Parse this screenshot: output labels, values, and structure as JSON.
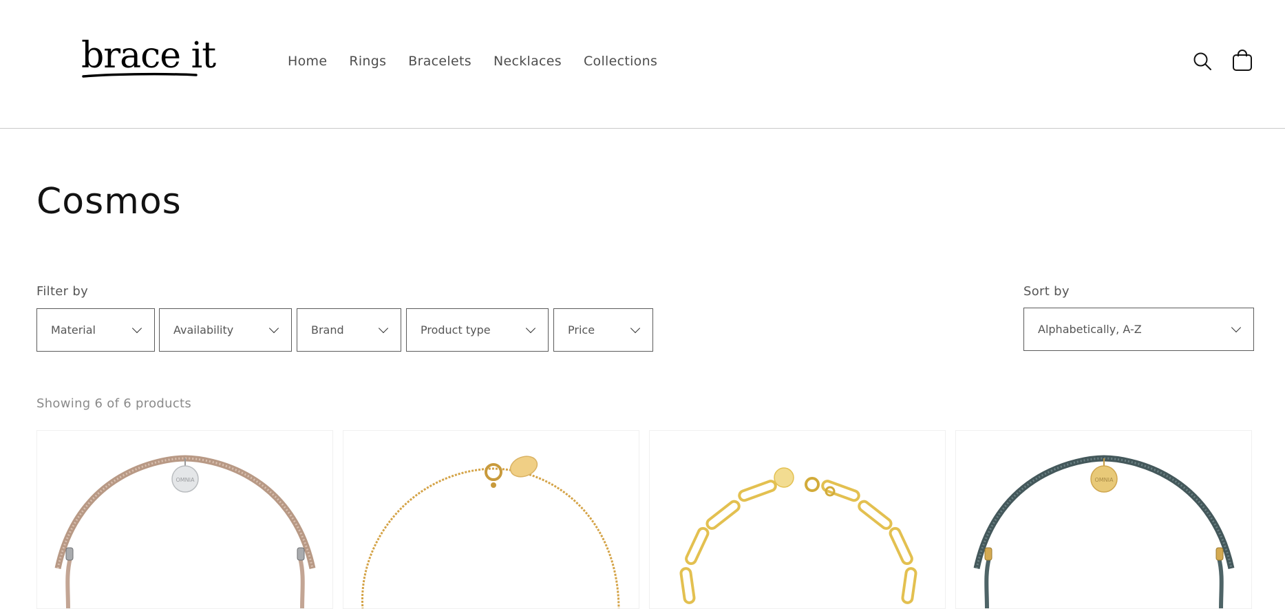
{
  "brand": {
    "logo_text": "brace it"
  },
  "nav": {
    "items": [
      "Home",
      "Rings",
      "Bracelets",
      "Necklaces",
      "Collections"
    ]
  },
  "icons": {
    "search": "search-icon",
    "cart": "bag-icon",
    "dropdown": "chevron-down-icon"
  },
  "collection": {
    "title": "Cosmos"
  },
  "filters": {
    "label": "Filter by",
    "items": [
      "Material",
      "Availability",
      "Brand",
      "Product type",
      "Price"
    ]
  },
  "sort": {
    "label": "Sort by",
    "value": "Alphabetically, A-Z"
  },
  "results": {
    "count_text": "Showing 6 of 6 products"
  },
  "products": [
    {
      "image": "beige cord bracelet with silver OMNIA tag",
      "tag_text": "OMNIA",
      "color": "#c9ab98"
    },
    {
      "image": "gold chain bracelet with oval tag",
      "tag_text": "",
      "color": "#d4a347"
    },
    {
      "image": "gold paperclip link bracelet",
      "tag_text": "",
      "color": "#e6c45a"
    },
    {
      "image": "teal cord bracelet with gold OMNIA tag",
      "tag_text": "OMNIA",
      "color": "#4e6467"
    }
  ],
  "colors": {
    "border": "#5a5a5a",
    "text": "#121212",
    "muted": "#8a8a8a"
  }
}
